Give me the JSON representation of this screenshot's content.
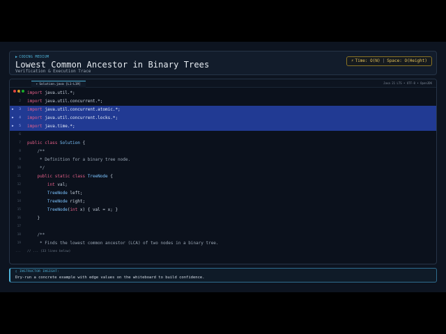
{
  "header": {
    "tag": "CODING MEDIUM",
    "title": "Lowest Common Ancestor in Binary Trees",
    "subtitle": "Verification & Execution Trace",
    "complexity": {
      "time": "Time: O(N)",
      "separator": "|",
      "space": "Space: O(Height)"
    }
  },
  "editor": {
    "tab_label": "Solution.java [L1-L19]",
    "meta": "Java 21 LTS • UTF-8 • OpenJDK",
    "lines": [
      {
        "n": "1",
        "hl": false,
        "parts": [
          {
            "c": "kw",
            "t": "import"
          },
          {
            "c": "",
            "t": " java.util.*;"
          }
        ]
      },
      {
        "n": "2",
        "hl": false,
        "parts": [
          {
            "c": "kw",
            "t": "import"
          },
          {
            "c": "",
            "t": " java.util.concurrent.*;"
          }
        ]
      },
      {
        "n": "3",
        "hl": true,
        "parts": [
          {
            "c": "kw",
            "t": "import"
          },
          {
            "c": "",
            "t": " java.util.concurrent.atomic.*;"
          }
        ]
      },
      {
        "n": "4",
        "hl": true,
        "parts": [
          {
            "c": "kw",
            "t": "import"
          },
          {
            "c": "",
            "t": " java.util.concurrent.locks.*;"
          }
        ]
      },
      {
        "n": "5",
        "hl": true,
        "parts": [
          {
            "c": "kw",
            "t": "import"
          },
          {
            "c": "",
            "t": " java.time.*;"
          }
        ]
      },
      {
        "n": "6",
        "hl": false,
        "parts": []
      },
      {
        "n": "7",
        "hl": false,
        "parts": [
          {
            "c": "kw",
            "t": "public class"
          },
          {
            "c": "",
            "t": " "
          },
          {
            "c": "ty",
            "t": "Solution"
          },
          {
            "c": "",
            "t": " {"
          }
        ]
      },
      {
        "n": "8",
        "hl": false,
        "parts": [
          {
            "c": "cm",
            "t": "    /**"
          }
        ]
      },
      {
        "n": "9",
        "hl": false,
        "parts": [
          {
            "c": "cm",
            "t": "     * Definition for a binary tree node."
          }
        ]
      },
      {
        "n": "10",
        "hl": false,
        "parts": [
          {
            "c": "cm",
            "t": "     */"
          }
        ]
      },
      {
        "n": "11",
        "hl": false,
        "parts": [
          {
            "c": "",
            "t": "    "
          },
          {
            "c": "kw",
            "t": "public static class"
          },
          {
            "c": "",
            "t": " "
          },
          {
            "c": "ty",
            "t": "TreeNode"
          },
          {
            "c": "",
            "t": " {"
          }
        ]
      },
      {
        "n": "12",
        "hl": false,
        "parts": [
          {
            "c": "",
            "t": "        "
          },
          {
            "c": "kw",
            "t": "int"
          },
          {
            "c": "",
            "t": " val;"
          }
        ]
      },
      {
        "n": "13",
        "hl": false,
        "parts": [
          {
            "c": "",
            "t": "        "
          },
          {
            "c": "ty",
            "t": "TreeNode"
          },
          {
            "c": "",
            "t": " left;"
          }
        ]
      },
      {
        "n": "14",
        "hl": false,
        "parts": [
          {
            "c": "",
            "t": "        "
          },
          {
            "c": "ty",
            "t": "TreeNode"
          },
          {
            "c": "",
            "t": " right;"
          }
        ]
      },
      {
        "n": "15",
        "hl": false,
        "parts": [
          {
            "c": "",
            "t": "        "
          },
          {
            "c": "ty",
            "t": "TreeNode"
          },
          {
            "c": "",
            "t": "("
          },
          {
            "c": "kw",
            "t": "int"
          },
          {
            "c": "",
            "t": " x) { val = x; }"
          }
        ]
      },
      {
        "n": "16",
        "hl": false,
        "parts": [
          {
            "c": "",
            "t": "    }"
          }
        ]
      },
      {
        "n": "17",
        "hl": false,
        "parts": []
      },
      {
        "n": "18",
        "hl": false,
        "parts": [
          {
            "c": "cm",
            "t": "    /**"
          }
        ]
      },
      {
        "n": "19",
        "hl": false,
        "parts": [
          {
            "c": "cm",
            "t": "     * Finds the lowest common ancestor (LCA) of two nodes in a binary tree."
          }
        ]
      }
    ],
    "more_gutter": "...",
    "more_text": "// ... (33 lines below)"
  },
  "insight": {
    "label": "INSTRUCTOR INSIGHT:",
    "text": "Dry-run a concrete example with edge values on the whiteboard to build confidence."
  },
  "colors": {
    "background": "#0d1420",
    "accent": "#4fb3d9",
    "highlight": "#213a93",
    "keyword": "#e8608a",
    "type": "#7cc4ff",
    "complexity": "#e7c45a"
  }
}
